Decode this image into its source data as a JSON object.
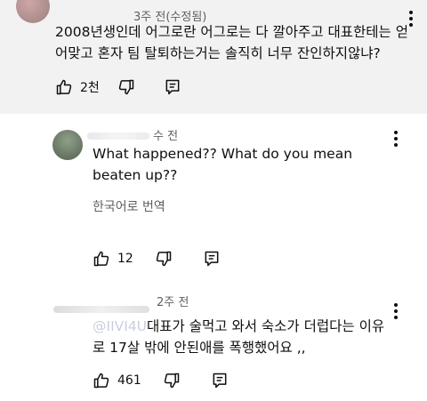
{
  "comments": [
    {
      "timestamp": "3주 전(수정됨)",
      "body": "2008년생인데 어그로란 어그로는 다 깔아주고 대표한테는 얻어맞고 혼자 팀 탈퇴하는거는 솔직히 너무 잔인하지않냐?",
      "likes": "2천",
      "icons": {
        "like": "thumbs-up-icon",
        "dislike": "thumbs-down-icon",
        "reply": "reply-icon",
        "menu": "more-vert-icon"
      }
    },
    {
      "timestamp": "수 전",
      "body": "What happened?? What do you mean beaten up??",
      "translate": "한국어로 번역",
      "likes": "12"
    },
    {
      "timestamp": "2주 전",
      "mention": "@IIVI4U",
      "body": "대표가 술먹고 와서 숙소가 더럽다는 이유로 17살 밖에 안된애를 폭행했어요 ,,",
      "likes": "461"
    }
  ],
  "colors": {
    "highlight_bg": "#f2f2f2",
    "mention": "#3b6fd6",
    "muted": "#606060"
  }
}
